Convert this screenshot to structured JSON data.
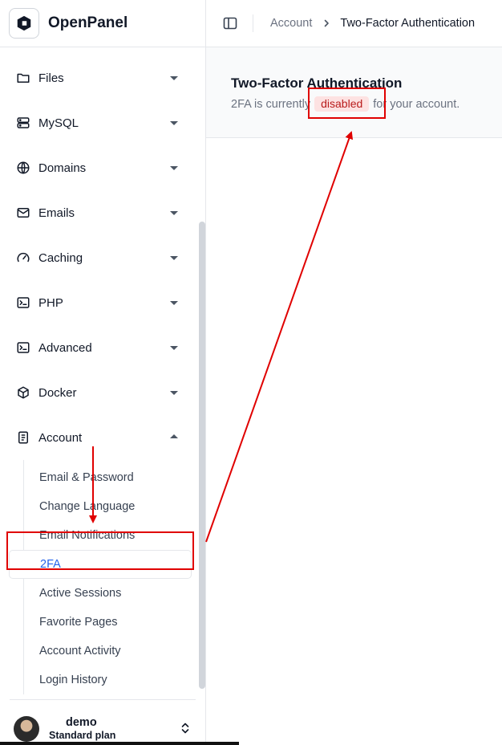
{
  "app": {
    "name": "OpenPanel"
  },
  "sidebar": {
    "items": [
      {
        "label": "Files",
        "icon": "folder-icon"
      },
      {
        "label": "MySQL",
        "icon": "database-icon"
      },
      {
        "label": "Domains",
        "icon": "globe-icon"
      },
      {
        "label": "Emails",
        "icon": "mail-icon"
      },
      {
        "label": "Caching",
        "icon": "gauge-icon"
      },
      {
        "label": "PHP",
        "icon": "terminal-icon"
      },
      {
        "label": "Advanced",
        "icon": "terminal-icon"
      },
      {
        "label": "Docker",
        "icon": "package-icon"
      },
      {
        "label": "Account",
        "icon": "document-icon",
        "expanded": true
      }
    ],
    "account_submenu": [
      "Email & Password",
      "Change Language",
      "Email Notifications",
      "2FA",
      "Active Sessions",
      "Favorite Pages",
      "Account Activity",
      "Login History"
    ],
    "active_submenu": "2FA"
  },
  "user": {
    "name": "demo",
    "plan": "Standard plan"
  },
  "breadcrumb": {
    "parent": "Account",
    "current": "Two-Factor Authentication"
  },
  "panel": {
    "title": "Two-Factor Authentication",
    "text_before": "2FA is currently",
    "status": "disabled",
    "text_after": "for your account."
  },
  "colors": {
    "accent": "#2563eb",
    "status_bg": "#fde2e2",
    "status_text": "#b91c1c",
    "annotation": "#e00000"
  }
}
